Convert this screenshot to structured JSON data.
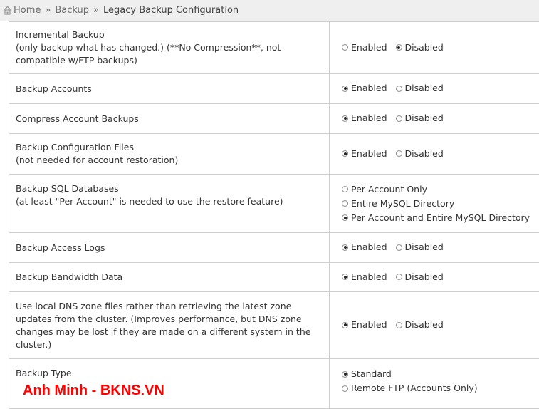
{
  "breadcrumb": {
    "home": "Home",
    "section": "Backup",
    "current": "Legacy Backup Configuration",
    "separator": "»"
  },
  "rows": [
    {
      "label_line1": "Incremental Backup",
      "label_line2": "(only backup what has changed.) (**No Compression**, not",
      "label_line3": "compatible w/FTP backups)",
      "options": [
        {
          "label": "Enabled",
          "checked": false
        },
        {
          "label": "Disabled",
          "checked": true
        }
      ]
    },
    {
      "label_line1": "Backup Accounts",
      "options": [
        {
          "label": "Enabled",
          "checked": true
        },
        {
          "label": "Disabled",
          "checked": false
        }
      ]
    },
    {
      "label_line1": "Compress Account Backups",
      "options": [
        {
          "label": "Enabled",
          "checked": true
        },
        {
          "label": "Disabled",
          "checked": false
        }
      ]
    },
    {
      "label_line1": "Backup Configuration Files",
      "label_line2": "(not needed for account restoration)",
      "options": [
        {
          "label": "Enabled",
          "checked": true
        },
        {
          "label": "Disabled",
          "checked": false
        }
      ]
    },
    {
      "label_line1": "Backup SQL Databases",
      "label_line2": "(at least \"Per Account\" is needed to use the restore feature)",
      "options": [
        {
          "label": "Per Account Only",
          "checked": false
        },
        {
          "label": "Entire MySQL Directory",
          "checked": false
        },
        {
          "label": "Per Account and Entire MySQL Directory",
          "checked": true
        }
      ]
    },
    {
      "label_line1": "Backup Access Logs",
      "options": [
        {
          "label": "Enabled",
          "checked": true
        },
        {
          "label": "Disabled",
          "checked": false
        }
      ]
    },
    {
      "label_line1": "Backup Bandwidth Data",
      "options": [
        {
          "label": "Enabled",
          "checked": true
        },
        {
          "label": "Disabled",
          "checked": false
        }
      ]
    },
    {
      "label_line1": "Use local DNS zone files rather than retrieving the latest zone",
      "label_line2": "updates from the cluster. (Improves performance, but DNS zone",
      "label_line3": "changes may be lost if they are made on a different system in the",
      "label_line4": "cluster.)",
      "options": [
        {
          "label": "Enabled",
          "checked": true
        },
        {
          "label": "Disabled",
          "checked": false
        }
      ]
    },
    {
      "label_line1": "Backup Type",
      "options": [
        {
          "label": "Standard",
          "checked": true
        },
        {
          "label": "Remote FTP (Accounts Only)",
          "checked": false
        }
      ]
    }
  ],
  "watermark": "Anh Minh - BKNS.VN",
  "colors": {
    "watermark": "#ff0000",
    "breadcrumb_bg": "#efefef",
    "border": "#cfcfcf"
  }
}
